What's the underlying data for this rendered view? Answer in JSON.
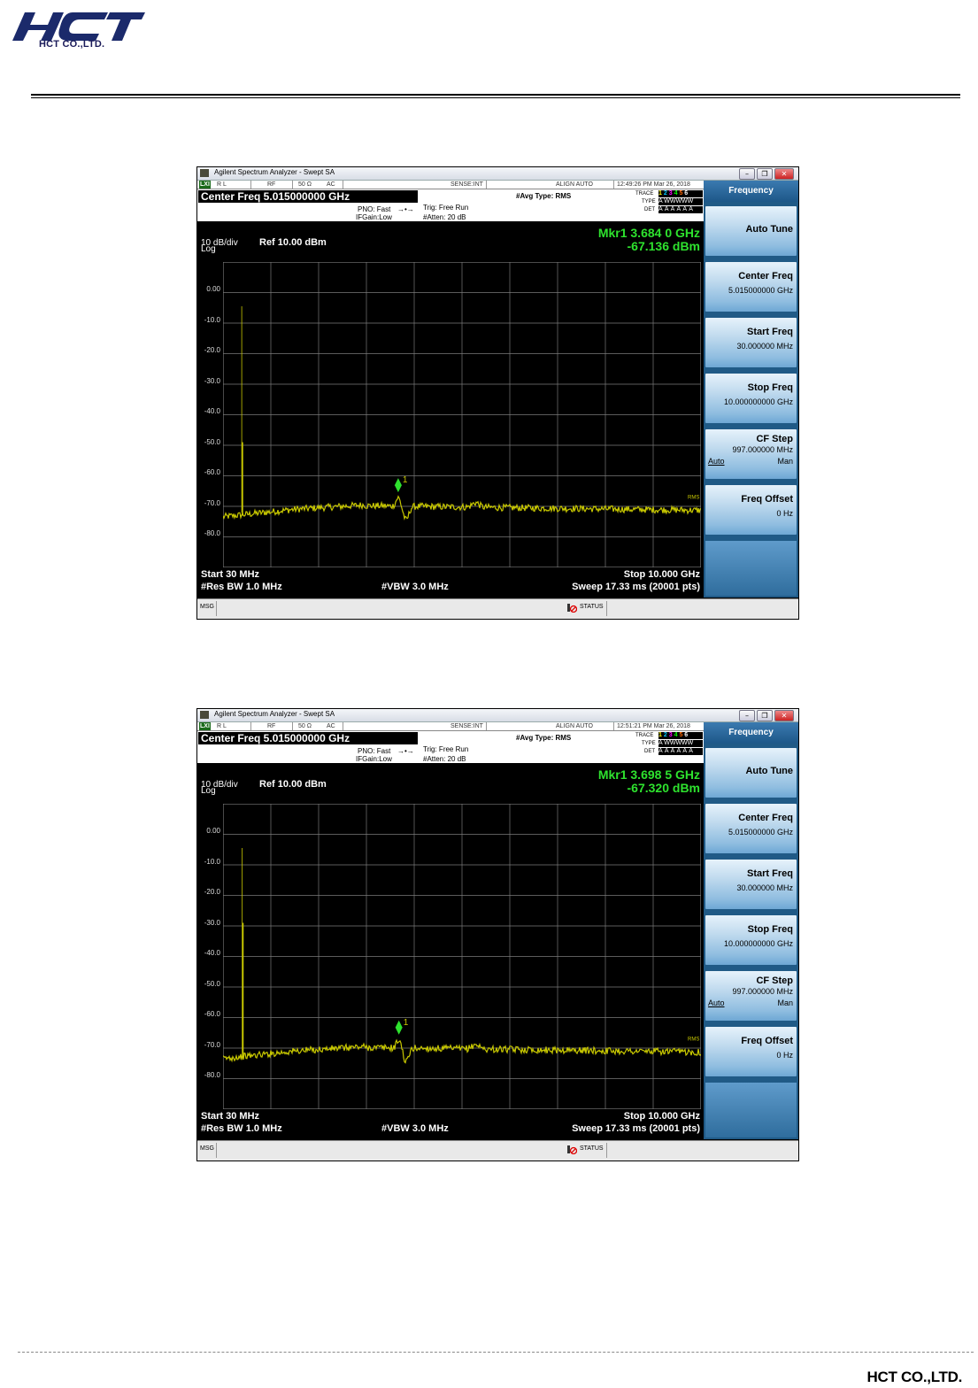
{
  "header": {
    "logo_text": "HCT",
    "company": "HCT CO.,LTD."
  },
  "footer": {
    "company": "HCT CO.,LTD."
  },
  "colors": {
    "trace": "#c8c800",
    "marker": "#2ee22e",
    "grid": "#7a7a7a",
    "softkey_panel": "#205a86"
  },
  "screenshots": [
    {
      "window_title": "Agilent Spectrum Analyzer - Swept SA",
      "status": {
        "xi": "LXI",
        "rl": "R L",
        "rf": "RF",
        "ohm": "50 Ω",
        "ac": "AC",
        "sense": "SENSE:INT",
        "align": "ALIGN AUTO",
        "time": "12:49:26 PM Mar 26, 2018"
      },
      "center_freq": "Center Freq 5.015000000 GHz",
      "pno": "PNO: Fast",
      "ifgain": "IFGain:Low",
      "trig": "Trig: Free Run",
      "atten": "#Atten: 20 dB",
      "avg_type": "#Avg Type: RMS",
      "trace_labels": {
        "trace": "TRACE",
        "type": "TYPE",
        "det": "DET",
        "trace_nums": "1 2 3 4 5 6",
        "type_val": "A WWWWW",
        "det_val": "A A A A A A"
      },
      "marker_freq": "Mkr1 3.684 0 GHz",
      "marker_amp": "-67.136 dBm",
      "scale": "10 dB/div",
      "log": "Log",
      "ref": "Ref 10.00 dBm",
      "y_ticks": [
        "0.00",
        "-10.0",
        "-20.0",
        "-30.0",
        "-40.0",
        "-50.0",
        "-60.0",
        "-70.0",
        "-80.0"
      ],
      "rms_label": "RMS",
      "marker_label": "1",
      "start": "Start 30 MHz",
      "stop": "Stop 10.000 GHz",
      "res_bw": "#Res BW  1.0 MHz",
      "vbw": "#VBW 3.0 MHz",
      "sweep": "Sweep   17.33 ms (20001 pts)",
      "msg": "MSG",
      "status_label": "STATUS",
      "softkey_title": "Frequency",
      "softkeys": [
        {
          "label": "Auto Tune",
          "value": ""
        },
        {
          "label": "Center Freq",
          "value": "5.015000000 GHz"
        },
        {
          "label": "Start Freq",
          "value": "30.000000 MHz"
        },
        {
          "label": "Stop Freq",
          "value": "10.000000000 GHz"
        },
        {
          "label": "CF Step",
          "value": "997.000000 MHz",
          "auto": "Auto",
          "man": "Man"
        },
        {
          "label": "Freq Offset",
          "value": "0 Hz"
        }
      ],
      "trace_data": {
        "marker_x_ghz": 3.684,
        "marker_dbm": -67.136,
        "spur_x_ghz": 0.42,
        "spur_peak_dbm": -4.5,
        "spur2_dbm": -49,
        "noise_floor_dbm": -71
      }
    },
    {
      "window_title": "Agilent Spectrum Analyzer - Swept SA",
      "status": {
        "xi": "LXI",
        "rl": "R L",
        "rf": "RF",
        "ohm": "50 Ω",
        "ac": "AC",
        "sense": "SENSE:INT",
        "align": "ALIGN AUTO",
        "time": "12:51:21 PM Mar 26, 2018"
      },
      "center_freq": "Center Freq 5.015000000 GHz",
      "pno": "PNO: Fast",
      "ifgain": "IFGain:Low",
      "trig": "Trig: Free Run",
      "atten": "#Atten: 20 dB",
      "avg_type": "#Avg Type: RMS",
      "trace_labels": {
        "trace": "TRACE",
        "type": "TYPE",
        "det": "DET",
        "trace_nums": "1 2 3 4 5 6",
        "type_val": "A WWWWW",
        "det_val": "A A A A A A"
      },
      "marker_freq": "Mkr1 3.698 5 GHz",
      "marker_amp": "-67.320 dBm",
      "scale": "10 dB/div",
      "log": "Log",
      "ref": "Ref 10.00 dBm",
      "y_ticks": [
        "0.00",
        "-10.0",
        "-20.0",
        "-30.0",
        "-40.0",
        "-50.0",
        "-60.0",
        "-70.0",
        "-80.0"
      ],
      "rms_label": "RMS",
      "marker_label": "1",
      "start": "Start 30 MHz",
      "stop": "Stop 10.000 GHz",
      "res_bw": "#Res BW  1.0 MHz",
      "vbw": "#VBW 3.0 MHz",
      "sweep": "Sweep   17.33 ms (20001 pts)",
      "msg": "MSG",
      "status_label": "STATUS",
      "softkey_title": "Frequency",
      "softkeys": [
        {
          "label": "Auto Tune",
          "value": ""
        },
        {
          "label": "Center Freq",
          "value": "5.015000000 GHz"
        },
        {
          "label": "Start Freq",
          "value": "30.000000 MHz"
        },
        {
          "label": "Stop Freq",
          "value": "10.000000000 GHz"
        },
        {
          "label": "CF Step",
          "value": "997.000000 MHz",
          "auto": "Auto",
          "man": "Man"
        },
        {
          "label": "Freq Offset",
          "value": "0 Hz"
        }
      ],
      "trace_data": {
        "marker_x_ghz": 3.6985,
        "marker_dbm": -67.32,
        "spur_x_ghz": 0.43,
        "spur_peak_dbm": -4.5,
        "spur2_dbm": -29,
        "noise_floor_dbm": -71
      }
    }
  ]
}
